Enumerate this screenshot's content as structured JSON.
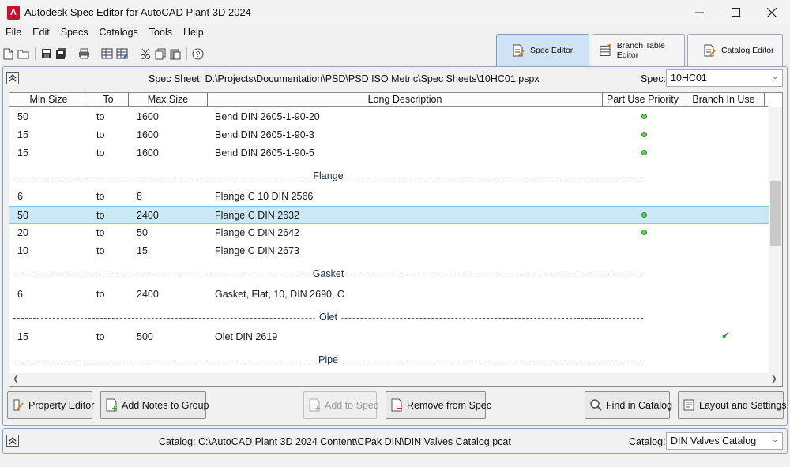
{
  "app": {
    "title": "Autodesk Spec Editor for AutoCAD Plant 3D 2024",
    "icon_letter": "A"
  },
  "window_controls": {
    "minimize": "—",
    "maximize": "☐",
    "close": "✕"
  },
  "menu": [
    "File",
    "Edit",
    "Specs",
    "Catalogs",
    "Tools",
    "Help"
  ],
  "toolbar_icons": [
    "new-icon",
    "open-icon",
    "save-icon",
    "save-all-icon",
    "print-icon",
    "grid-icon",
    "grid-edit-icon",
    "cut-icon",
    "copy-icon",
    "paste-icon",
    "help-icon"
  ],
  "mode_tabs": [
    {
      "label": "Spec Editor",
      "active": true
    },
    {
      "label": "Branch Table Editor",
      "active": false
    },
    {
      "label": "Catalog Editor",
      "active": false
    }
  ],
  "spec_panel": {
    "sheet_label": "Spec Sheet: D:\\Projects\\Documentation\\PSD\\PSD ISO Metric\\Spec Sheets\\10HC01.pspx",
    "spec_label": "Spec:",
    "spec_value": "10HC01"
  },
  "grid": {
    "columns": [
      "Min Size",
      "To",
      "Max Size",
      "Long Description",
      "Part Use Priority",
      "Branch In Use"
    ],
    "rows": [
      {
        "kind": "item",
        "min": "50",
        "to": "to",
        "max": "1600",
        "desc": "Bend DIN 2605-1-90-20",
        "priority": true,
        "branch": false,
        "selected": false
      },
      {
        "kind": "item",
        "min": "15",
        "to": "to",
        "max": "1600",
        "desc": "Bend DIN 2605-1-90-3",
        "priority": true,
        "branch": false,
        "selected": false
      },
      {
        "kind": "item",
        "min": "15",
        "to": "to",
        "max": "1600",
        "desc": "Bend DIN 2605-1-90-5",
        "priority": true,
        "branch": false,
        "selected": false
      },
      {
        "kind": "group",
        "label": "Flange"
      },
      {
        "kind": "item",
        "min": "6",
        "to": "to",
        "max": "8",
        "desc": "Flange C 10 DIN 2566",
        "priority": false,
        "branch": false,
        "selected": false
      },
      {
        "kind": "item",
        "min": "50",
        "to": "to",
        "max": "2400",
        "desc": "Flange C DIN 2632",
        "priority": true,
        "branch": false,
        "selected": true
      },
      {
        "kind": "item",
        "min": "20",
        "to": "to",
        "max": "50",
        "desc": "Flange C DIN 2642",
        "priority": true,
        "branch": false,
        "selected": false
      },
      {
        "kind": "item",
        "min": "10",
        "to": "to",
        "max": "15",
        "desc": "Flange C DIN 2673",
        "priority": false,
        "branch": false,
        "selected": false
      },
      {
        "kind": "group",
        "label": "Gasket"
      },
      {
        "kind": "item",
        "min": "6",
        "to": "to",
        "max": "2400",
        "desc": "Gasket, Flat, 10, DIN 2690, C",
        "priority": false,
        "branch": false,
        "selected": false
      },
      {
        "kind": "group",
        "label": "Olet"
      },
      {
        "kind": "item",
        "min": "15",
        "to": "to",
        "max": "500",
        "desc": "Olet DIN 2619",
        "priority": false,
        "branch": true,
        "selected": false
      },
      {
        "kind": "group",
        "label": "Pipe"
      }
    ]
  },
  "buttons": {
    "property_editor": "Property Editor",
    "add_notes": "Add Notes to Group",
    "add_to_spec": "Add to Spec",
    "remove_from_spec": "Remove from Spec",
    "find_in_catalog": "Find in Catalog",
    "layout_settings": "Layout and Settings"
  },
  "catalog_panel": {
    "catalog_path_label": "Catalog: C:\\AutoCAD Plant 3D 2024 Content\\CPak DIN\\DIN Valves Catalog.pcat",
    "catalog_label": "Catalog:",
    "catalog_value": "DIN Valves Catalog"
  },
  "colors": {
    "accent_tab": "#cfe3f5",
    "selected_row": "#cbe8f6",
    "priority_dot": "#5fd64c",
    "check": "#1f9c2a"
  }
}
